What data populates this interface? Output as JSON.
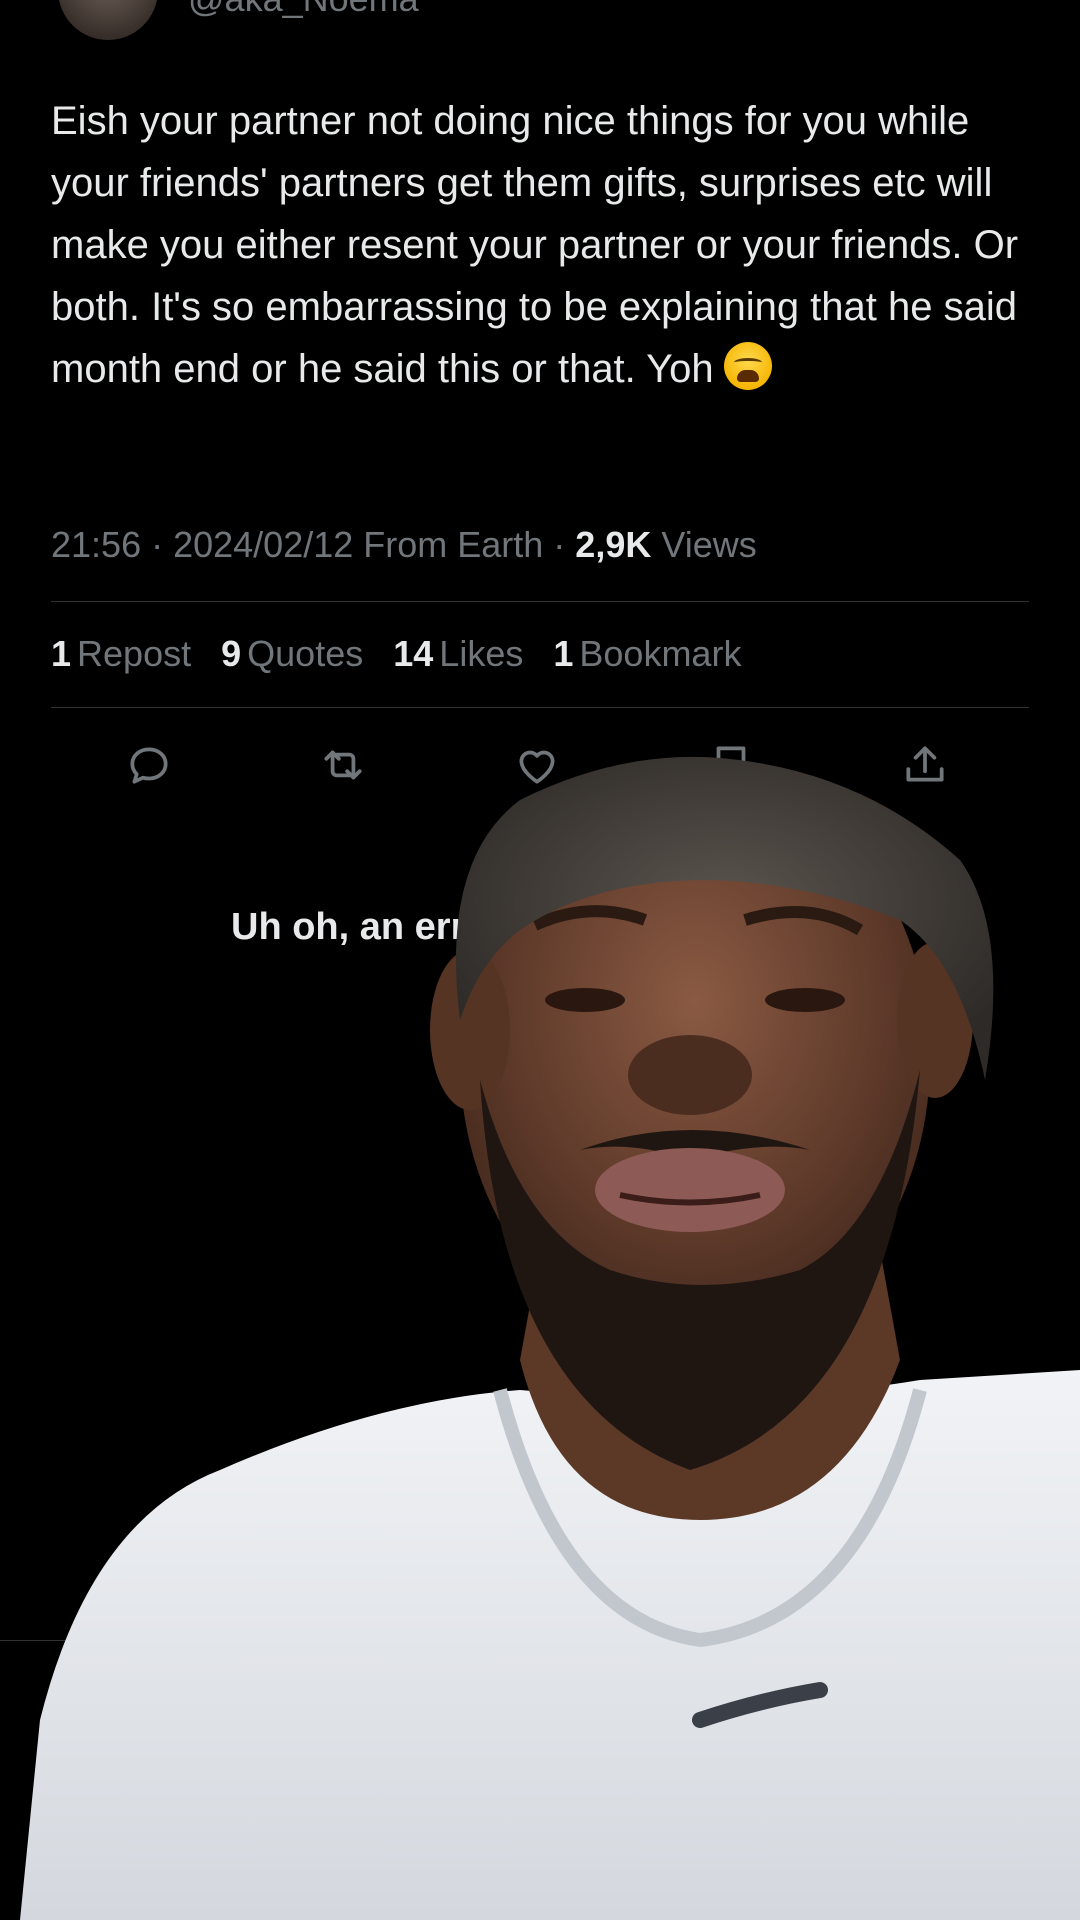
{
  "header": {
    "handle": "@aka_Noema"
  },
  "tweet": {
    "text": "Eish your partner not doing nice things for you while your friends' partners get them gifts, surprises etc will make you either resent your partner or your friends. Or both. It's so embarrassing to be explaining that he said month end or he said this or that. Yoh",
    "emoji": "weary-face-emoji"
  },
  "meta": {
    "time_date_location": "21:56 · 2024/02/12 From Earth · ",
    "views_count": "2,9K",
    "views_label": " Views"
  },
  "stats": {
    "reposts_count": "1",
    "reposts_label": "Repost",
    "quotes_count": "9",
    "quotes_label": "Quotes",
    "likes_count": "14",
    "likes_label": "Likes",
    "bookmarks_count": "1",
    "bookmarks_label": "Bookmark"
  },
  "actions": {
    "icons": [
      "reply-icon",
      "repost-icon",
      "like-icon",
      "bookmark-icon",
      "share-icon"
    ]
  },
  "error": {
    "text": "Uh oh, an erro"
  },
  "colors": {
    "background": "#000000",
    "text_primary": "#e7e9ea",
    "text_secondary": "#71767b",
    "divider": "#2f3336"
  }
}
